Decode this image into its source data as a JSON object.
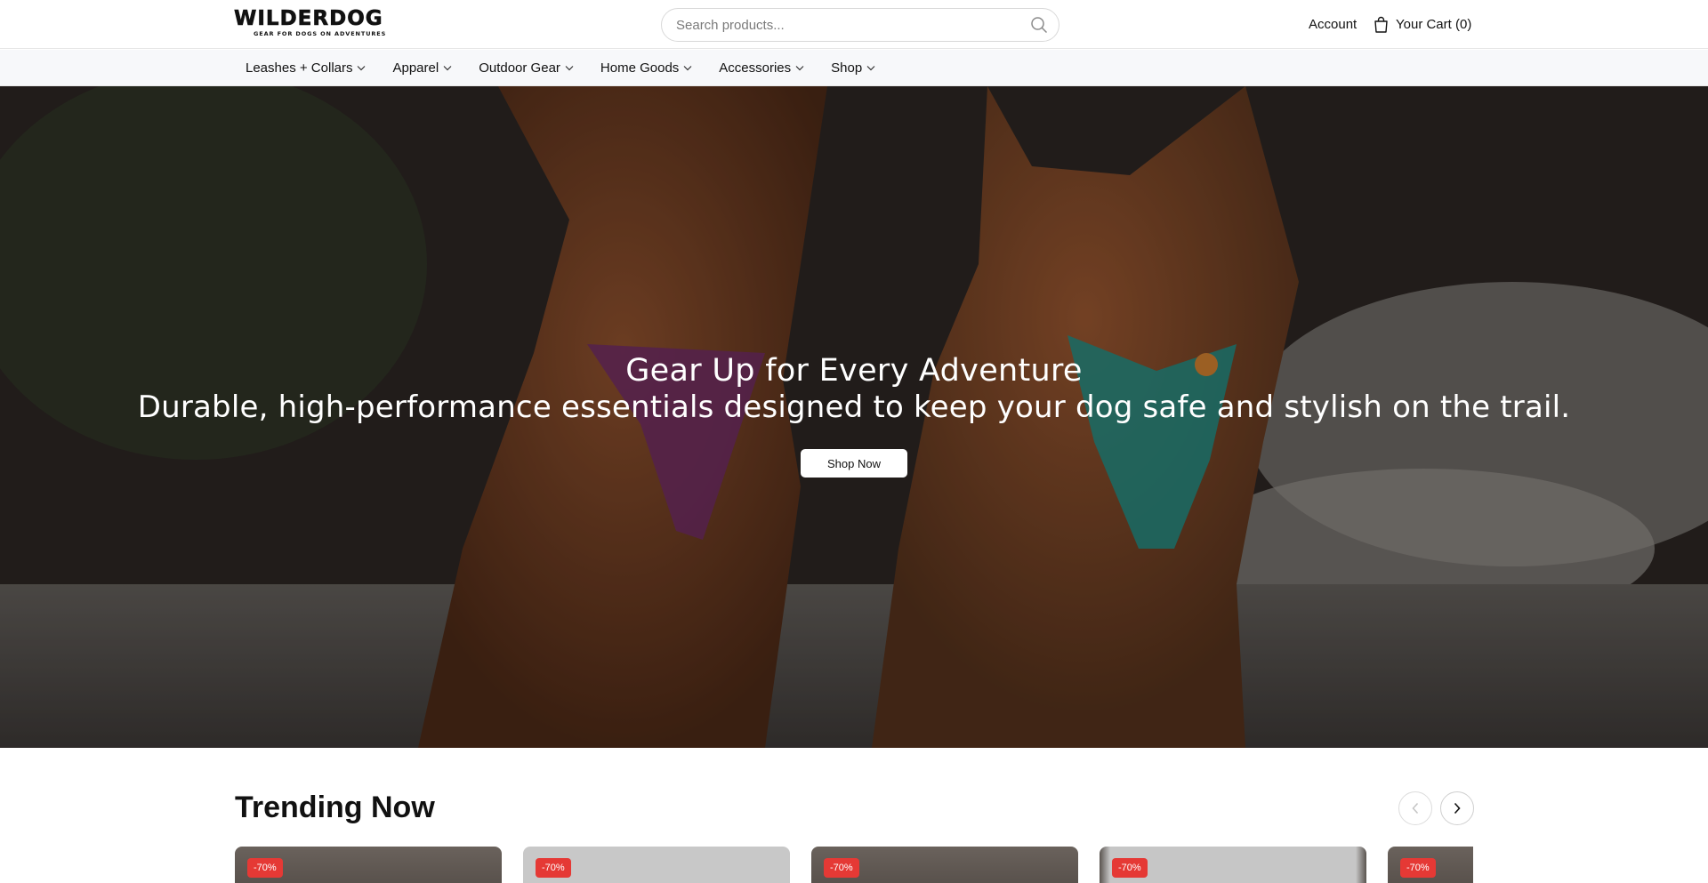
{
  "header": {
    "logo_text": "WILDERDOG",
    "logo_tagline": "GEAR FOR DOGS ON ADVENTURES",
    "search_placeholder": "Search products...",
    "account_label": "Account",
    "cart_label": "Your Cart (0)"
  },
  "nav": {
    "items": [
      {
        "label": "Leashes + Collars",
        "icon": "chevron-down-icon"
      },
      {
        "label": "Apparel",
        "icon": "chevron-down-icon"
      },
      {
        "label": "Outdoor Gear",
        "icon": "chevron-down-icon"
      },
      {
        "label": "Home Goods",
        "icon": "chevron-down-icon"
      },
      {
        "label": "Accessories",
        "icon": "chevron-down-icon"
      },
      {
        "label": "Shop",
        "icon": "chevron-down-icon"
      }
    ]
  },
  "hero": {
    "title": "Gear Up for Every Adventure",
    "subtitle": "Durable, high-performance essentials designed to keep your dog safe and stylish on the trail.",
    "cta_label": "Shop Now"
  },
  "trending": {
    "title": "Trending Now",
    "products": [
      {
        "badge": "-70%"
      },
      {
        "badge": "-70%"
      },
      {
        "badge": "-70%"
      },
      {
        "badge": "-70%"
      },
      {
        "badge": "-70%"
      }
    ]
  },
  "colors": {
    "badge": "#e53935",
    "nav_background": "#f7f8fa",
    "text": "#111111"
  }
}
